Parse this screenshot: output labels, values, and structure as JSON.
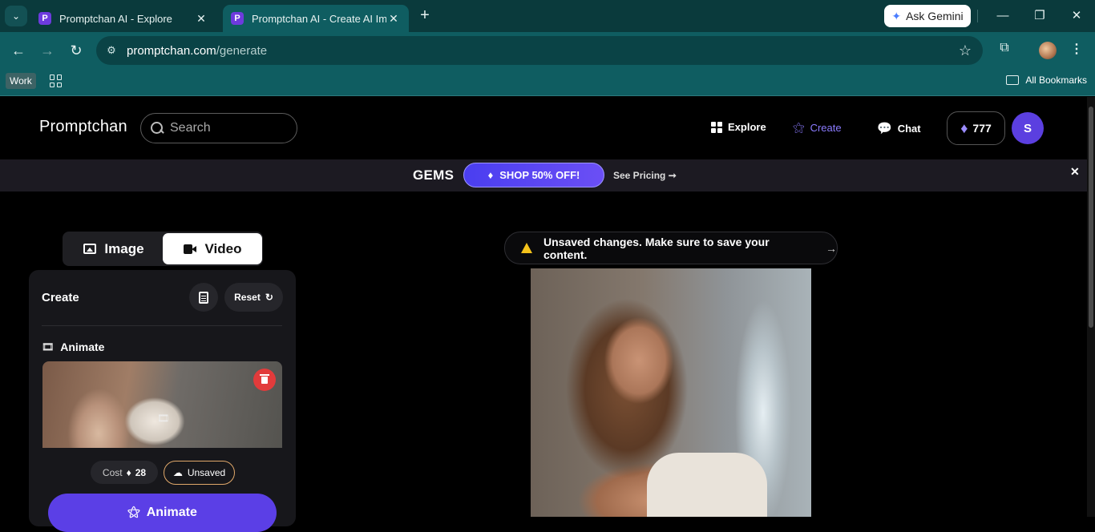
{
  "browser": {
    "tabs": [
      {
        "title": "Promptchan AI - Explore",
        "favicon": "P"
      },
      {
        "title": "Promptchan AI - Create AI Imag",
        "favicon": "P"
      }
    ],
    "ask_gemini": "Ask Gemini",
    "url_host": "promptchan.com",
    "url_path": "/generate",
    "bookmarks": {
      "work": "Work",
      "all": "All Bookmarks"
    }
  },
  "header": {
    "logo": "Promptchan",
    "search_placeholder": "Search",
    "nav": {
      "explore": "Explore",
      "create": "Create",
      "chat": "Chat"
    },
    "gems": "777",
    "avatar_letter": "S"
  },
  "promo": {
    "gems": "GEMS",
    "shop": "SHOP 50% OFF!",
    "pricing": "See Pricing ➞",
    "close": "✕"
  },
  "toggle": {
    "image": "Image",
    "video": "Video"
  },
  "panel": {
    "title": "Create",
    "reset": "Reset",
    "animate_label": "Animate",
    "cost_label": "Cost",
    "cost_value": "28",
    "unsaved": "Unsaved",
    "animate_button": "Animate"
  },
  "notice": {
    "text": "Unsaved changes. Make sure to save your content.",
    "arrow": "→"
  },
  "colors": {
    "accent": "#5b3fe6",
    "chrome": "#0f5d61",
    "warning": "#f4c21b",
    "danger": "#e23b3b"
  }
}
